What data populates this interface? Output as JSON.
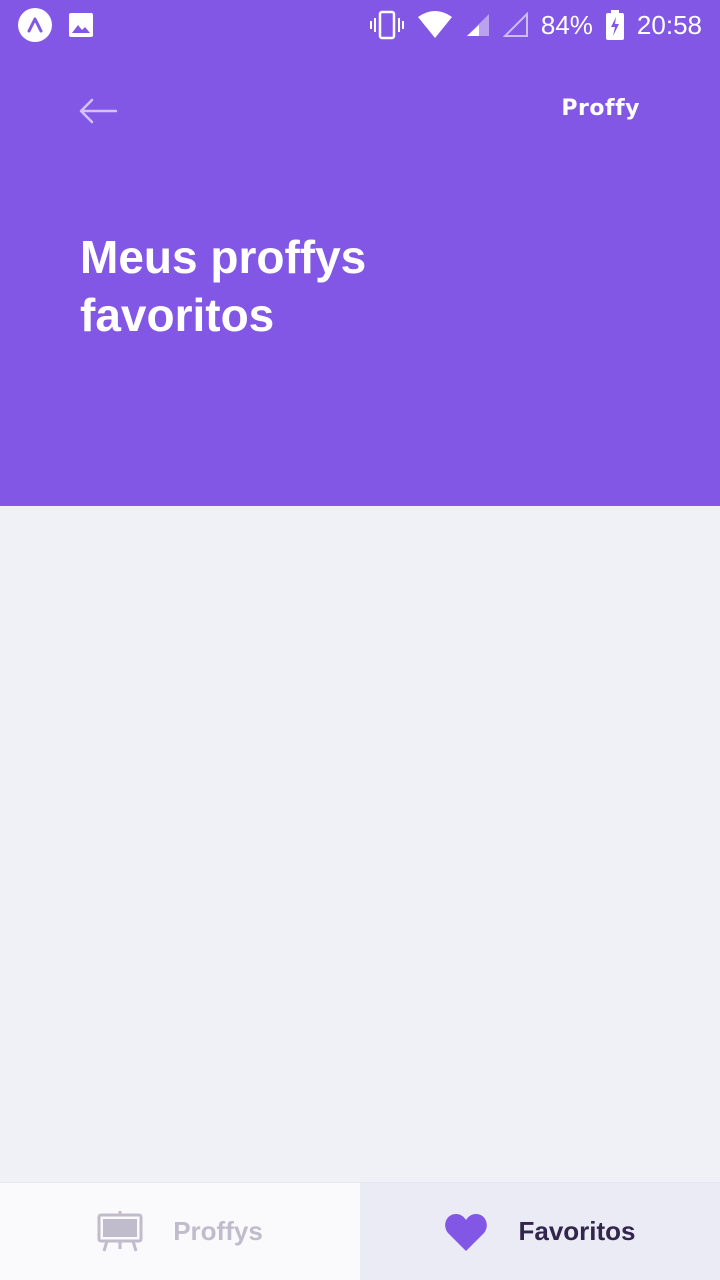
{
  "status_bar": {
    "battery_percent": "84%",
    "time": "20:58",
    "icons": [
      "expo-icon",
      "image-icon",
      "vibrate-icon",
      "wifi-icon",
      "signal-icon",
      "signal-empty-icon",
      "battery-charging-icon"
    ]
  },
  "header": {
    "logo": "Proffy",
    "title_line1": "Meus proffys",
    "title_line2": "favoritos",
    "back_icon": "arrow-left-icon"
  },
  "tabs": [
    {
      "label": "Proffys",
      "icon": "easel-icon",
      "active": false
    },
    {
      "label": "Favoritos",
      "icon": "heart-icon",
      "active": true
    }
  ],
  "colors": {
    "primary": "#8257E5",
    "background": "#F0F0F7",
    "tab_active_bg": "#EBEBF5",
    "tab_inactive_bg": "#FAFAFC",
    "tab_active_text": "#32264D",
    "tab_inactive_text": "#C1BCCC"
  }
}
